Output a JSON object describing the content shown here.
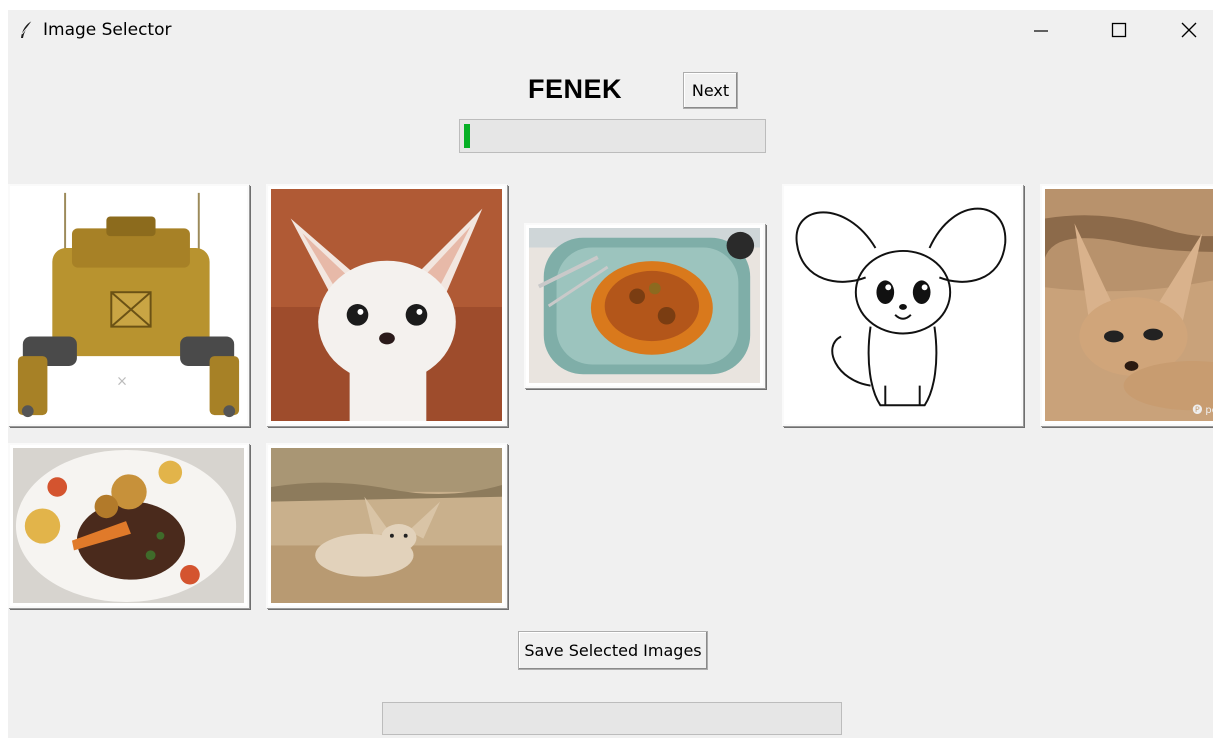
{
  "window": {
    "title": "Image Selector"
  },
  "header": {
    "label": "FENEK",
    "next_button": "Next"
  },
  "progress": {
    "fraction": 0.02,
    "color": "#06b025"
  },
  "images": [
    {
      "name": "mech-robot-image"
    },
    {
      "name": "fennec-fox-closeup-image"
    },
    {
      "name": "vegetable-dish-plate-image"
    },
    {
      "name": "cartoon-mouse-drawing-image"
    },
    {
      "name": "fennec-fox-lying-image"
    },
    {
      "name": "stew-plate-image"
    },
    {
      "name": "fennec-fox-sleeping-image"
    }
  ],
  "footer": {
    "save_button": "Save Selected Images",
    "status_text": ""
  },
  "icons": {
    "app": "feather-icon",
    "minimize": "minimize-icon",
    "maximize": "maximize-icon",
    "close": "close-icon"
  }
}
